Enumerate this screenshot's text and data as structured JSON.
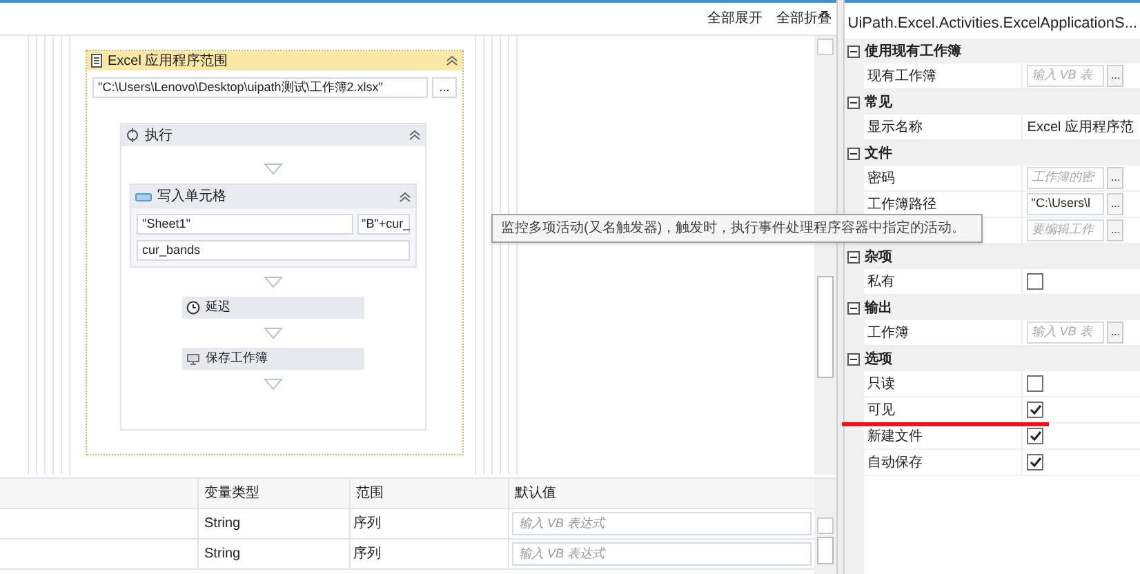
{
  "toolbar": {
    "buttons": [
      "全部展开",
      "全部折叠"
    ]
  },
  "designer": {
    "scope": {
      "title": "Excel 应用程序范围",
      "path_value": "\"C:\\Users\\Lenovo\\Desktop\\uipath测试\\工作簿2.xlsx\"",
      "path_button": "...",
      "expanded": true,
      "sequence": {
        "title": "执行",
        "expanded": true,
        "activities": [
          {
            "kind": "write_cell",
            "title": "写入单元格",
            "expanded": true,
            "sheet": "\"Sheet1\"",
            "cell": "\"B\"+cur_",
            "value": "cur_bands"
          },
          {
            "kind": "delay",
            "title": "延迟"
          },
          {
            "kind": "save",
            "title": "保存工作簿"
          }
        ]
      }
    }
  },
  "tooltip": "监控多项活动(又名触发器)，触发时，执行事件处理程序容器中指定的活动。",
  "variables": {
    "columns": [
      "变量类型",
      "范围",
      "默认值"
    ],
    "rows": [
      {
        "type": "String",
        "scope": "序列",
        "default_placeholder": "输入 VB 表达式"
      },
      {
        "type": "String",
        "scope": "序列",
        "default_placeholder": "输入 VB 表达式"
      }
    ]
  },
  "properties": {
    "title": "UiPath.Excel.Activities.ExcelApplicationS...",
    "groups": [
      {
        "label": "使用现有工作簿",
        "expanded": true,
        "items": [
          {
            "label": "现有工作簿",
            "kind": "field",
            "placeholder": "输入 VB 表",
            "button": "..."
          }
        ]
      },
      {
        "label": "常见",
        "expanded": true,
        "items": [
          {
            "label": "显示名称",
            "kind": "text",
            "value": "Excel 应用程序范"
          }
        ]
      },
      {
        "label": "文件",
        "expanded": true,
        "items": [
          {
            "label": "密码",
            "kind": "field",
            "placeholder": "工作簿的密",
            "button": "..."
          },
          {
            "label": "工作簿路径",
            "kind": "field",
            "value": "\"C:\\Users\\l",
            "button": "..."
          },
          {
            "kind": "field",
            "placeholder": "要编辑工作",
            "button": "..."
          }
        ]
      },
      {
        "label": "杂项",
        "expanded": true,
        "items": [
          {
            "label": "私有",
            "kind": "checkbox",
            "checked": false
          }
        ]
      },
      {
        "label": "输出",
        "expanded": true,
        "items": [
          {
            "label": "工作簿",
            "kind": "field",
            "placeholder": "输入 VB 表",
            "button": "..."
          }
        ]
      },
      {
        "label": "选项",
        "expanded": true,
        "items": [
          {
            "label": "只读",
            "kind": "checkbox",
            "checked": false
          },
          {
            "label": "可见",
            "kind": "checkbox",
            "checked": true,
            "underlined": true
          },
          {
            "label": "新建文件",
            "kind": "checkbox",
            "checked": true
          },
          {
            "label": "自动保存",
            "kind": "checkbox",
            "checked": true
          }
        ]
      }
    ]
  }
}
